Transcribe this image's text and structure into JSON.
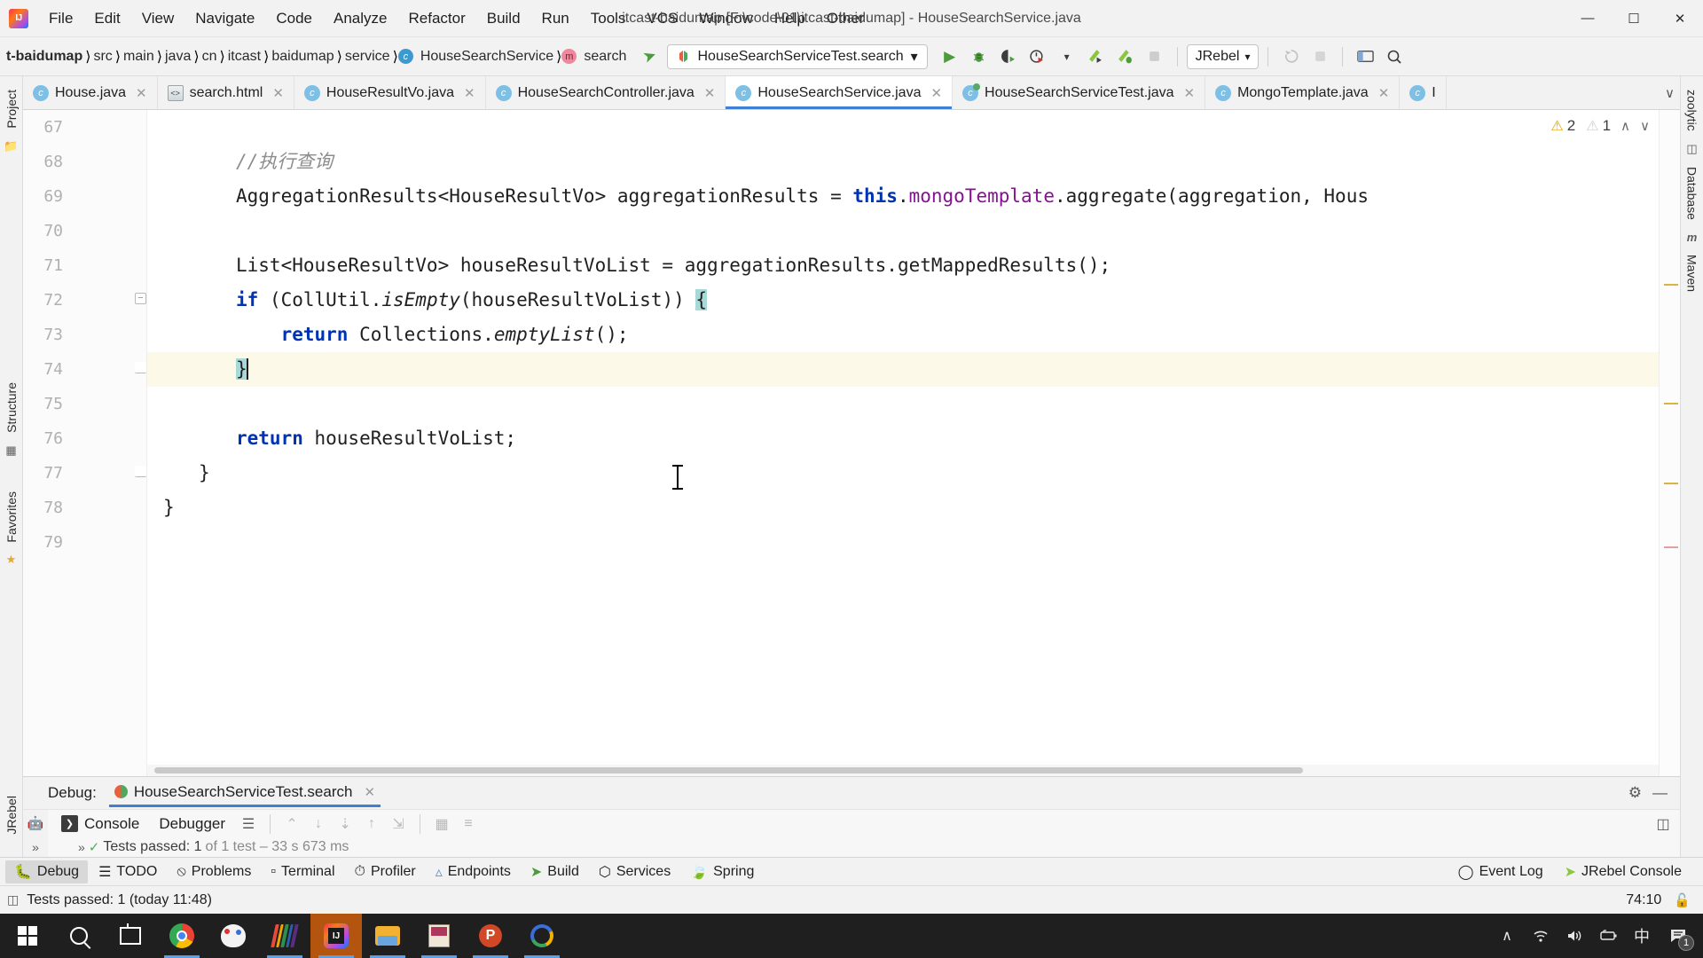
{
  "window": {
    "title": "itcast-baidumap [F:\\code\\01\\itcast-baidumap] - HouseSearchService.java",
    "minimize": "—",
    "maximize": "☐",
    "close": "✕"
  },
  "menu": [
    {
      "label": "File"
    },
    {
      "label": "Edit"
    },
    {
      "label": "View"
    },
    {
      "label": "Navigate"
    },
    {
      "label": "Code"
    },
    {
      "label": "Analyze"
    },
    {
      "label": "Refactor"
    },
    {
      "label": "Build"
    },
    {
      "label": "Run"
    },
    {
      "label": "Tools"
    },
    {
      "label": "VCS"
    },
    {
      "label": "Window"
    },
    {
      "label": "Help"
    },
    {
      "label": "Other"
    }
  ],
  "breadcrumb": [
    {
      "label": "t-baidumap",
      "kind": "project"
    },
    {
      "label": "src",
      "kind": "dir"
    },
    {
      "label": "main",
      "kind": "dir"
    },
    {
      "label": "java",
      "kind": "dir"
    },
    {
      "label": "cn",
      "kind": "dir"
    },
    {
      "label": "itcast",
      "kind": "dir"
    },
    {
      "label": "baidumap",
      "kind": "dir"
    },
    {
      "label": "service",
      "kind": "dir"
    },
    {
      "label": "HouseSearchService",
      "kind": "class",
      "badge": "c"
    },
    {
      "label": "search",
      "kind": "method",
      "badge": "m"
    }
  ],
  "toolbar": {
    "run_config": "HouseSearchServiceTest.search",
    "run_config_caret": "▾",
    "jrebel_label": "JRebel",
    "jrebel_caret": "▾",
    "icons": {
      "run": "▶",
      "debug": "debug-bug-icon",
      "run_coverage": "coverage-icon",
      "profiler": "profiler-icon",
      "profiler_caret": "▾",
      "jrebel_run": "jrebel-run-icon",
      "jrebel_debug": "jrebel-debug-icon",
      "stop": "■",
      "update": "update-icon",
      "layout": "layout-icon",
      "search_everywhere": "⚲"
    }
  },
  "editor_tabs": [
    {
      "label": "House.java",
      "icon": "java-class-icon",
      "badge": "c",
      "active": false
    },
    {
      "label": "search.html",
      "icon": "html-file-icon",
      "badge": "",
      "active": false
    },
    {
      "label": "HouseResultVo.java",
      "icon": "java-class-icon",
      "badge": "c",
      "active": false
    },
    {
      "label": "HouseSearchController.java",
      "icon": "java-class-icon",
      "badge": "c",
      "active": false
    },
    {
      "label": "HouseSearchService.java",
      "icon": "java-class-icon",
      "badge": "c",
      "active": true
    },
    {
      "label": "HouseSearchServiceTest.java",
      "icon": "java-test-icon",
      "badge": "c",
      "active": false
    },
    {
      "label": "MongoTemplate.java",
      "icon": "java-class-icon",
      "badge": "c",
      "active": false
    },
    {
      "label": "I",
      "icon": "java-class-icon",
      "badge": "c",
      "active": false
    }
  ],
  "editor": {
    "inspections": {
      "warnings": "2",
      "weak_warnings": "1",
      "up": "∧",
      "down": "∨"
    },
    "lines": [
      {
        "num": "67",
        "text": "",
        "type": "blank"
      },
      {
        "num": "68",
        "text": "//执行查询",
        "type": "comment"
      },
      {
        "num": "69",
        "text": "AggregationResults<HouseResultVo> aggregationResults = this.mongoTemplate.aggregate(aggregation, Hous",
        "type": "code"
      },
      {
        "num": "70",
        "text": "",
        "type": "blank"
      },
      {
        "num": "71",
        "text": "List<HouseResultVo> houseResultVoList = aggregationResults.getMappedResults();",
        "type": "code"
      },
      {
        "num": "72",
        "text": "if (CollUtil.isEmpty(houseResultVoList)) {",
        "type": "code"
      },
      {
        "num": "73",
        "text": "    return Collections.emptyList();",
        "type": "code"
      },
      {
        "num": "74",
        "text": "}",
        "type": "code",
        "highlighted": true
      },
      {
        "num": "75",
        "text": "",
        "type": "blank"
      },
      {
        "num": "76",
        "text": "return houseResultVoList;",
        "type": "code"
      },
      {
        "num": "77",
        "text": "}",
        "type": "code"
      },
      {
        "num": "78",
        "text": "}",
        "type": "code"
      },
      {
        "num": "79",
        "text": "",
        "type": "blank"
      }
    ]
  },
  "right_rail": [
    {
      "label": "zoolytic",
      "icon": ""
    },
    {
      "label": "Database",
      "icon": "database-icon"
    },
    {
      "label": "Maven",
      "icon": "m"
    }
  ],
  "left_rail": [
    {
      "label": "Project",
      "icon": "project-icon"
    },
    {
      "label": "Structure",
      "icon": "structure-icon"
    },
    {
      "label": "Favorites",
      "icon": "favorites-icon"
    },
    {
      "label": "JRebel",
      "icon": "jrebel-icon"
    }
  ],
  "debug_window": {
    "title": "Debug:",
    "session": "HouseSearchServiceTest.search",
    "close": "✕",
    "settings_icon": "gear-icon",
    "hide_icon": "—",
    "tabs": [
      {
        "label": "Console",
        "active": true
      },
      {
        "label": "Debugger",
        "active": false
      }
    ],
    "test_result": {
      "prefix": "Tests passed: 1",
      "suffix": "of 1 test – 33 s 673 ms"
    },
    "expand": "»"
  },
  "tool_strip": {
    "left": [
      {
        "label": "Debug",
        "icon": "debug-icon",
        "active": true
      },
      {
        "label": "TODO",
        "icon": "todo-icon",
        "active": false
      },
      {
        "label": "Problems",
        "icon": "problems-icon",
        "active": false
      },
      {
        "label": "Terminal",
        "icon": "terminal-icon",
        "active": false
      },
      {
        "label": "Profiler",
        "icon": "profiler-icon",
        "active": false
      },
      {
        "label": "Endpoints",
        "icon": "endpoints-icon",
        "active": false
      },
      {
        "label": "Build",
        "icon": "build-icon",
        "active": false
      },
      {
        "label": "Services",
        "icon": "services-icon",
        "active": false
      },
      {
        "label": "Spring",
        "icon": "spring-icon",
        "active": false
      }
    ],
    "right": [
      {
        "label": "Event Log",
        "icon": "event-log-icon"
      },
      {
        "label": "JRebel Console",
        "icon": "jrebel-icon"
      }
    ]
  },
  "status_bar": {
    "message": "Tests passed: 1 (today 11:48)",
    "message_icon": "console-icon",
    "caret_position": "74:10",
    "lock_icon": "unlock-icon"
  },
  "taskbar": {
    "start": "windows-start-icon",
    "search": "search-icon",
    "taskview": "task-view-icon",
    "apps": [
      {
        "name": "chrome-icon",
        "running": true,
        "focused": false
      },
      {
        "name": "paint-icon",
        "running": false,
        "focused": false
      },
      {
        "name": "stripes-app-icon",
        "running": true,
        "focused": false
      },
      {
        "name": "intellij-idea-icon",
        "running": true,
        "focused": true
      },
      {
        "name": "file-explorer-icon",
        "running": true,
        "focused": false
      },
      {
        "name": "notes-app-icon",
        "running": true,
        "focused": false
      },
      {
        "name": "powerpoint-icon",
        "running": true,
        "focused": false
      },
      {
        "name": "ring-app-icon",
        "running": true,
        "focused": false
      }
    ],
    "tray": [
      {
        "name": "show-hidden-icons",
        "glyph": "∧"
      },
      {
        "name": "wifi-icon",
        "glyph": "wifi"
      },
      {
        "name": "volume-icon",
        "glyph": "volume"
      },
      {
        "name": "battery-icon",
        "glyph": "battery"
      },
      {
        "name": "ime-language-icon",
        "glyph": "中"
      },
      {
        "name": "notifications-icon",
        "glyph": "notif",
        "badge": "1"
      }
    ]
  },
  "colors": {
    "accent_blue": "#3f7fd4",
    "keyword": "#0033b3",
    "field": "#871094",
    "comment": "#8c8c8c",
    "highlight_line": "#fdf9e8",
    "brace_match": "#a8d8d8",
    "warning": "#eaa300",
    "taskbar_focus": "#b4550f"
  }
}
